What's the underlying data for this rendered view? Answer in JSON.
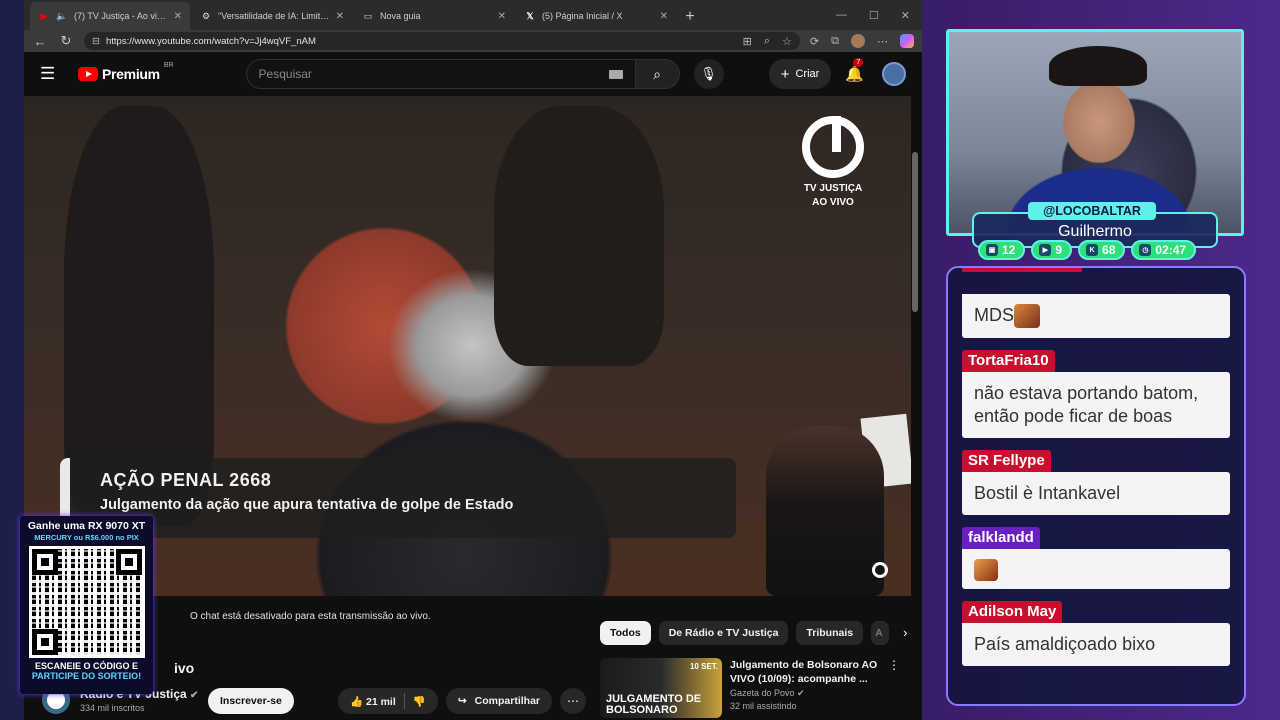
{
  "browser": {
    "tabs": [
      {
        "label": "(7) TV Justiça - Ao vivo - You",
        "icon": "youtube-icon",
        "active": true
      },
      {
        "label": "\"Versatilidade de IA: Limitações e",
        "icon": "chatgpt-icon",
        "active": false
      },
      {
        "label": "Nova guia",
        "icon": "new-tab-page-icon",
        "active": false
      },
      {
        "label": "(5) Página Inicial / X",
        "icon": "x-logo-icon",
        "active": false
      }
    ],
    "url": "https://www.youtube.com/watch?v=Jj4wqVF_nAM"
  },
  "youtube": {
    "logo_text": "Premium",
    "logo_region": "BR",
    "search_placeholder": "Pesquisar",
    "create_label": "Criar",
    "notifications_count": "7",
    "video": {
      "channel_brand_line1": "TV JUSTIÇA",
      "channel_brand_line2": "AO VIVO",
      "lower_third_title": "AÇÃO PENAL 2668",
      "lower_third_subtitle": "Julgamento da ação que apura tentativa de golpe de Estado"
    },
    "chat_disabled_text": "O chat está desativado para esta transmissão ao vivo.",
    "chips": [
      "Todos",
      "De Rádio e TV Justiça",
      "Tribunais",
      "A"
    ],
    "title_fragment": "ivo",
    "channel_name": "Rádio e TV Justiça",
    "channel_subs": "334 mil inscritos",
    "subscribe_label": "Inscrever-se",
    "like_count": "21 mil",
    "share_label": "Compartilhar",
    "recommendation": {
      "title": "Julgamento de Bolsonaro AO VIVO (10/09): acompanhe ...",
      "channel": "Gazeta do Povo",
      "meta": "32 mil assistindo",
      "thumb_date": "10 SET.",
      "thumb_text_1": "JULGAMENTO DE",
      "thumb_text_2": "BOLSONARO"
    }
  },
  "overlay": {
    "qr_line1": "Ganhe uma RX 9070 XT",
    "qr_line2": "MERCURY ou R$6.000 no PIX",
    "qr_cta1": "ESCANEIE O CÓDIGO E",
    "qr_cta2": "PARTICIPE DO SORTEIO!",
    "streamer_handle": "@LOCOBALTAR",
    "streamer_name": "Guilhermo",
    "stats": [
      {
        "icon": "twitch-icon",
        "value": "12"
      },
      {
        "icon": "youtube-icon",
        "value": "9"
      },
      {
        "icon": "kick-icon",
        "value": "68"
      },
      {
        "icon": "clock-icon",
        "value": "02:47"
      }
    ]
  },
  "chat_messages": [
    {
      "user": "",
      "text": "MDS",
      "emote": true
    },
    {
      "user": "TortaFria10",
      "text": "não estava portando batom, então pode ficar de boas",
      "emote": false
    },
    {
      "user": "SR Fellype",
      "text": "Bostil è Intankavel",
      "emote": false
    },
    {
      "user": "falklandd",
      "text": "",
      "emote": true
    },
    {
      "user": "Adilson May",
      "text": "País amaldiçoado bixo",
      "emote": false
    }
  ]
}
